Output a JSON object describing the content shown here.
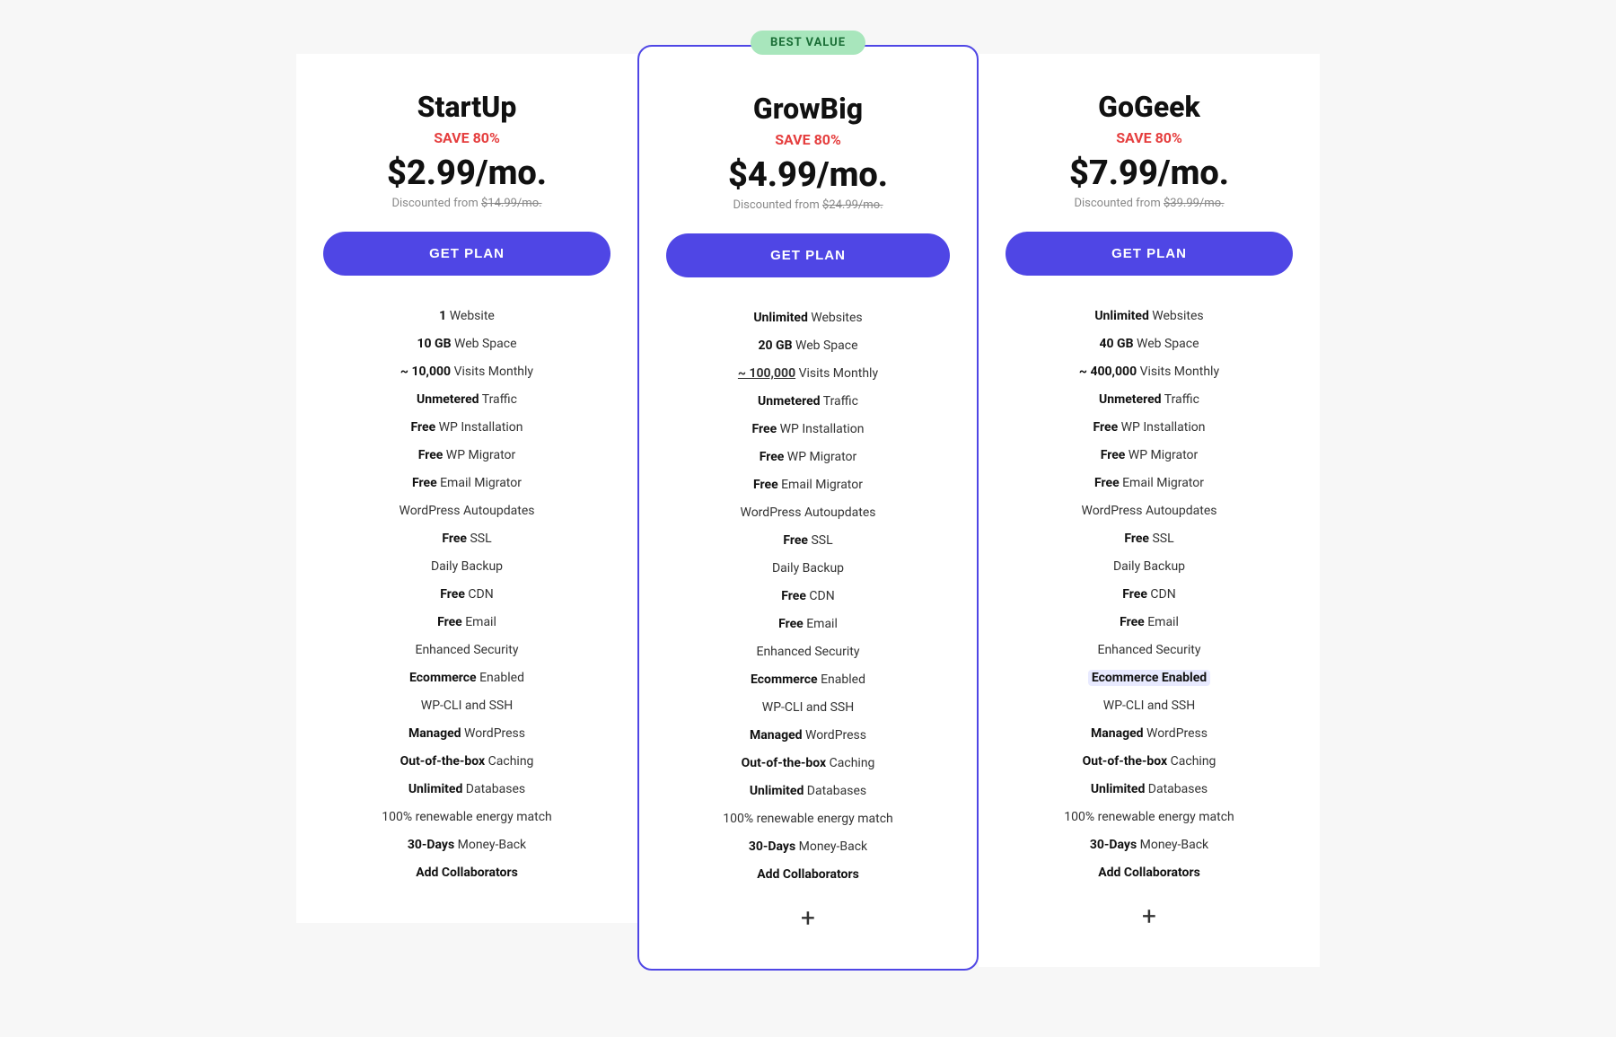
{
  "plans": [
    {
      "id": "startup",
      "name": "StartUp",
      "save": "SAVE 80%",
      "price": "$2.99/mo.",
      "discounted_from": "$14.99/mo.",
      "button_label": "GET PLAN",
      "featured": false,
      "best_value": false,
      "show_plus": false,
      "features": [
        {
          "bold": "1",
          "text": " Website"
        },
        {
          "bold": "10 GB",
          "text": " Web Space"
        },
        {
          "bold": "~ 10,000",
          "text": " Visits Monthly"
        },
        {
          "bold": "Unmetered",
          "text": " Traffic"
        },
        {
          "bold": "Free",
          "text": " WP Installation"
        },
        {
          "bold": "Free",
          "text": " WP Migrator"
        },
        {
          "bold": "Free",
          "text": " Email Migrator"
        },
        {
          "bold": "",
          "text": "WordPress Autoupdates"
        },
        {
          "bold": "Free",
          "text": " SSL"
        },
        {
          "bold": "",
          "text": "Daily Backup"
        },
        {
          "bold": "Free",
          "text": " CDN"
        },
        {
          "bold": "Free",
          "text": " Email"
        },
        {
          "bold": "",
          "text": "Enhanced Security"
        },
        {
          "bold": "Ecommerce",
          "text": " Enabled"
        },
        {
          "bold": "",
          "text": "WP-CLI and SSH"
        },
        {
          "bold": "Managed",
          "text": " WordPress"
        },
        {
          "bold": "Out-of-the-box",
          "text": " Caching"
        },
        {
          "bold": "Unlimited",
          "text": " Databases"
        },
        {
          "bold": "",
          "text": "100% renewable energy match"
        },
        {
          "bold": "30-Days",
          "text": " Money-Back"
        },
        {
          "bold": "Add Collaborators",
          "text": ""
        }
      ]
    },
    {
      "id": "growbig",
      "name": "GrowBig",
      "save": "SAVE 80%",
      "price": "$4.99/mo.",
      "discounted_from": "$24.99/mo.",
      "button_label": "GET PLAN",
      "featured": true,
      "best_value": true,
      "best_value_label": "BEST VALUE",
      "show_plus": true,
      "features": [
        {
          "bold": "Unlimited",
          "text": " Websites"
        },
        {
          "bold": "20 GB",
          "text": " Web Space"
        },
        {
          "bold": "~ 100,000",
          "text": " Visits Monthly",
          "underline": true
        },
        {
          "bold": "Unmetered",
          "text": " Traffic"
        },
        {
          "bold": "Free",
          "text": " WP Installation"
        },
        {
          "bold": "Free",
          "text": " WP Migrator"
        },
        {
          "bold": "Free",
          "text": " Email Migrator"
        },
        {
          "bold": "",
          "text": "WordPress Autoupdates"
        },
        {
          "bold": "Free",
          "text": " SSL"
        },
        {
          "bold": "",
          "text": "Daily Backup"
        },
        {
          "bold": "Free",
          "text": " CDN"
        },
        {
          "bold": "Free",
          "text": " Email"
        },
        {
          "bold": "",
          "text": "Enhanced Security"
        },
        {
          "bold": "Ecommerce",
          "text": " Enabled"
        },
        {
          "bold": "",
          "text": "WP-CLI and SSH"
        },
        {
          "bold": "Managed",
          "text": " WordPress"
        },
        {
          "bold": "Out-of-the-box",
          "text": " Caching"
        },
        {
          "bold": "Unlimited",
          "text": " Databases"
        },
        {
          "bold": "",
          "text": "100% renewable energy match"
        },
        {
          "bold": "30-Days",
          "text": " Money-Back"
        },
        {
          "bold": "Add Collaborators",
          "text": ""
        }
      ]
    },
    {
      "id": "gogeek",
      "name": "GoGeek",
      "save": "SAVE 80%",
      "price": "$7.99/mo.",
      "discounted_from": "$39.99/mo.",
      "button_label": "GET PLAN",
      "featured": false,
      "best_value": false,
      "show_plus": true,
      "features": [
        {
          "bold": "Unlimited",
          "text": " Websites"
        },
        {
          "bold": "40 GB",
          "text": " Web Space"
        },
        {
          "bold": "~ 400,000",
          "text": " Visits Monthly"
        },
        {
          "bold": "Unmetered",
          "text": " Traffic"
        },
        {
          "bold": "Free",
          "text": " WP Installation"
        },
        {
          "bold": "Free",
          "text": " WP Migrator"
        },
        {
          "bold": "Free",
          "text": " Email Migrator"
        },
        {
          "bold": "",
          "text": "WordPress Autoupdates"
        },
        {
          "bold": "Free",
          "text": " SSL"
        },
        {
          "bold": "",
          "text": "Daily Backup"
        },
        {
          "bold": "Free",
          "text": " CDN"
        },
        {
          "bold": "Free",
          "text": " Email"
        },
        {
          "bold": "",
          "text": "Enhanced Security"
        },
        {
          "bold": "Ecommerce",
          "text": " Enabled",
          "highlight": true
        },
        {
          "bold": "",
          "text": "WP-CLI and SSH"
        },
        {
          "bold": "Managed",
          "text": " WordPress"
        },
        {
          "bold": "Out-of-the-box",
          "text": " Caching"
        },
        {
          "bold": "Unlimited",
          "text": " Databases"
        },
        {
          "bold": "",
          "text": "100% renewable energy match"
        },
        {
          "bold": "30-Days",
          "text": " Money-Back"
        },
        {
          "bold": "Add Collaborators",
          "text": ""
        }
      ]
    }
  ],
  "colors": {
    "accent": "#4f46e5",
    "save": "#e53e3e",
    "badge_bg": "#a8e6bc",
    "badge_text": "#1a6e36"
  }
}
